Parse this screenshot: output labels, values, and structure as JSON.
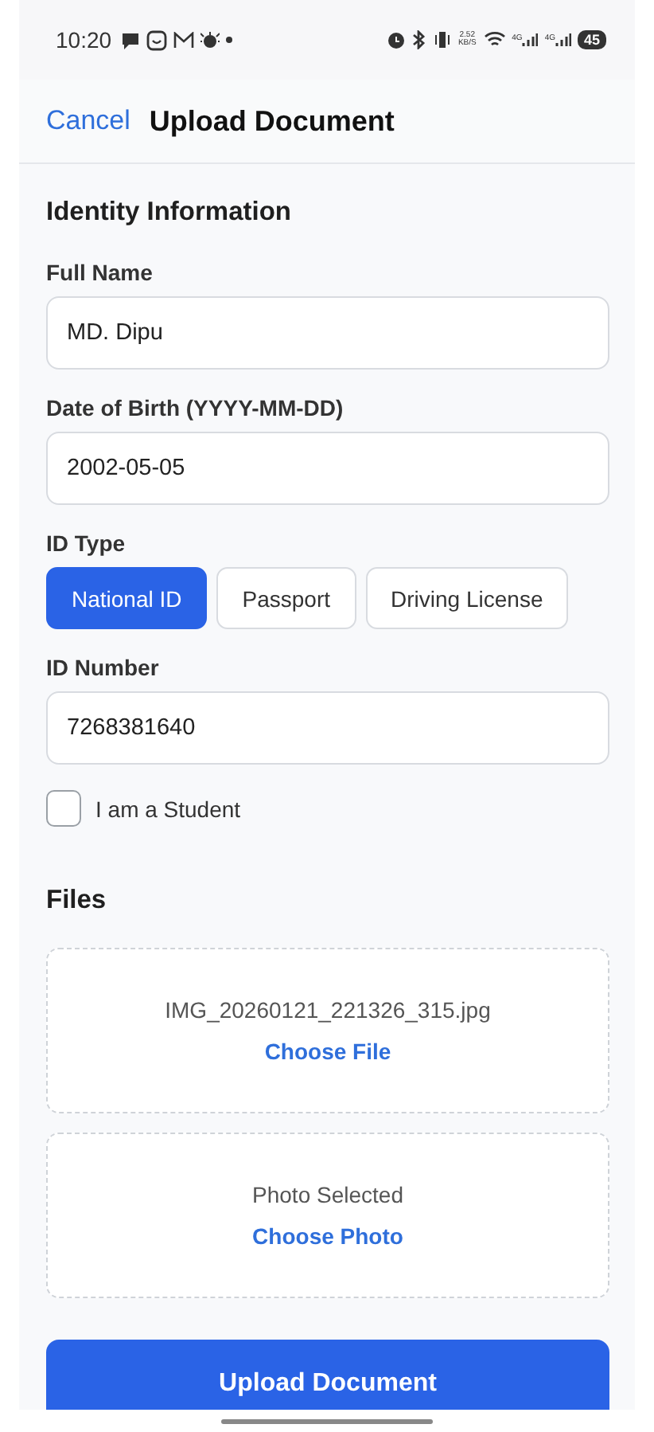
{
  "status_bar": {
    "time": "10:20",
    "speed": "2.52 KB/S",
    "network_1": "4G",
    "network_2": "4G",
    "battery": "45"
  },
  "header": {
    "cancel": "Cancel",
    "title": "Upload Document"
  },
  "identity": {
    "title": "Identity Information",
    "fields": [
      {
        "kind": "text",
        "label": "Full Name",
        "value": "MD. Dipu"
      },
      {
        "kind": "text",
        "label": "Date of Birth (YYYY-MM-DD)",
        "value": "2002-05-05"
      },
      {
        "kind": "segments",
        "label": "ID Type",
        "options": [
          {
            "label": "National ID",
            "selected": true
          },
          {
            "label": "Passport",
            "selected": false
          },
          {
            "label": "Driving License",
            "selected": false
          }
        ]
      },
      {
        "kind": "text",
        "label": "ID Number",
        "value": "7268381640"
      },
      {
        "kind": "checkbox",
        "label": "I am a Student",
        "checked": false
      }
    ]
  },
  "files": {
    "title": "Files",
    "slots": [
      {
        "caption": "IMG_20260121_221326_315.jpg",
        "action": "Choose File"
      },
      {
        "caption": "Photo Selected",
        "action": "Choose Photo"
      }
    ]
  },
  "submit": "Upload Document"
}
